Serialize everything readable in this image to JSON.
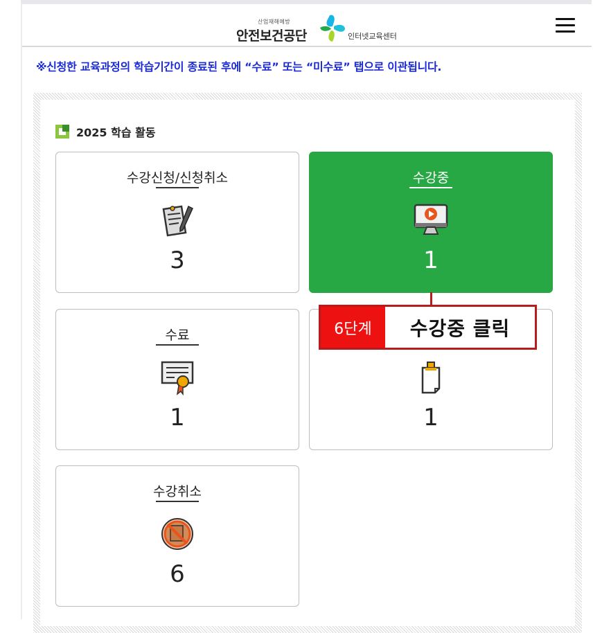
{
  "header": {
    "logo_small": "산업재해예방",
    "logo_main": "안전보건공단",
    "logo_sub": "인터넷교육센터"
  },
  "notice": "※신청한 교육과정의 학습기간이 종료된 후에 “수료” 또는 “미수료” 탭으로 이관됩니다.",
  "section": {
    "title": "2025 학습 활동"
  },
  "cards": [
    {
      "label": "수강신청/신청취소",
      "count": "3",
      "icon": "pen-paper-icon",
      "active": false
    },
    {
      "label": "수강중",
      "count": "1",
      "icon": "monitor-play-icon",
      "active": true
    },
    {
      "label": "수료",
      "count": "1",
      "icon": "certificate-icon",
      "active": false
    },
    {
      "label": "",
      "count": "1",
      "icon": "clipboard-note-icon",
      "active": false
    },
    {
      "label": "수강취소",
      "count": "6",
      "icon": "cancel-document-icon",
      "active": false
    }
  ],
  "callout": {
    "step": "6단계",
    "text": "수강중 클릭"
  },
  "colors": {
    "active_green": "#28a745",
    "notice_blue": "#1a2bd6",
    "callout_red": "#ee1111",
    "callout_border": "#b71c1c"
  }
}
